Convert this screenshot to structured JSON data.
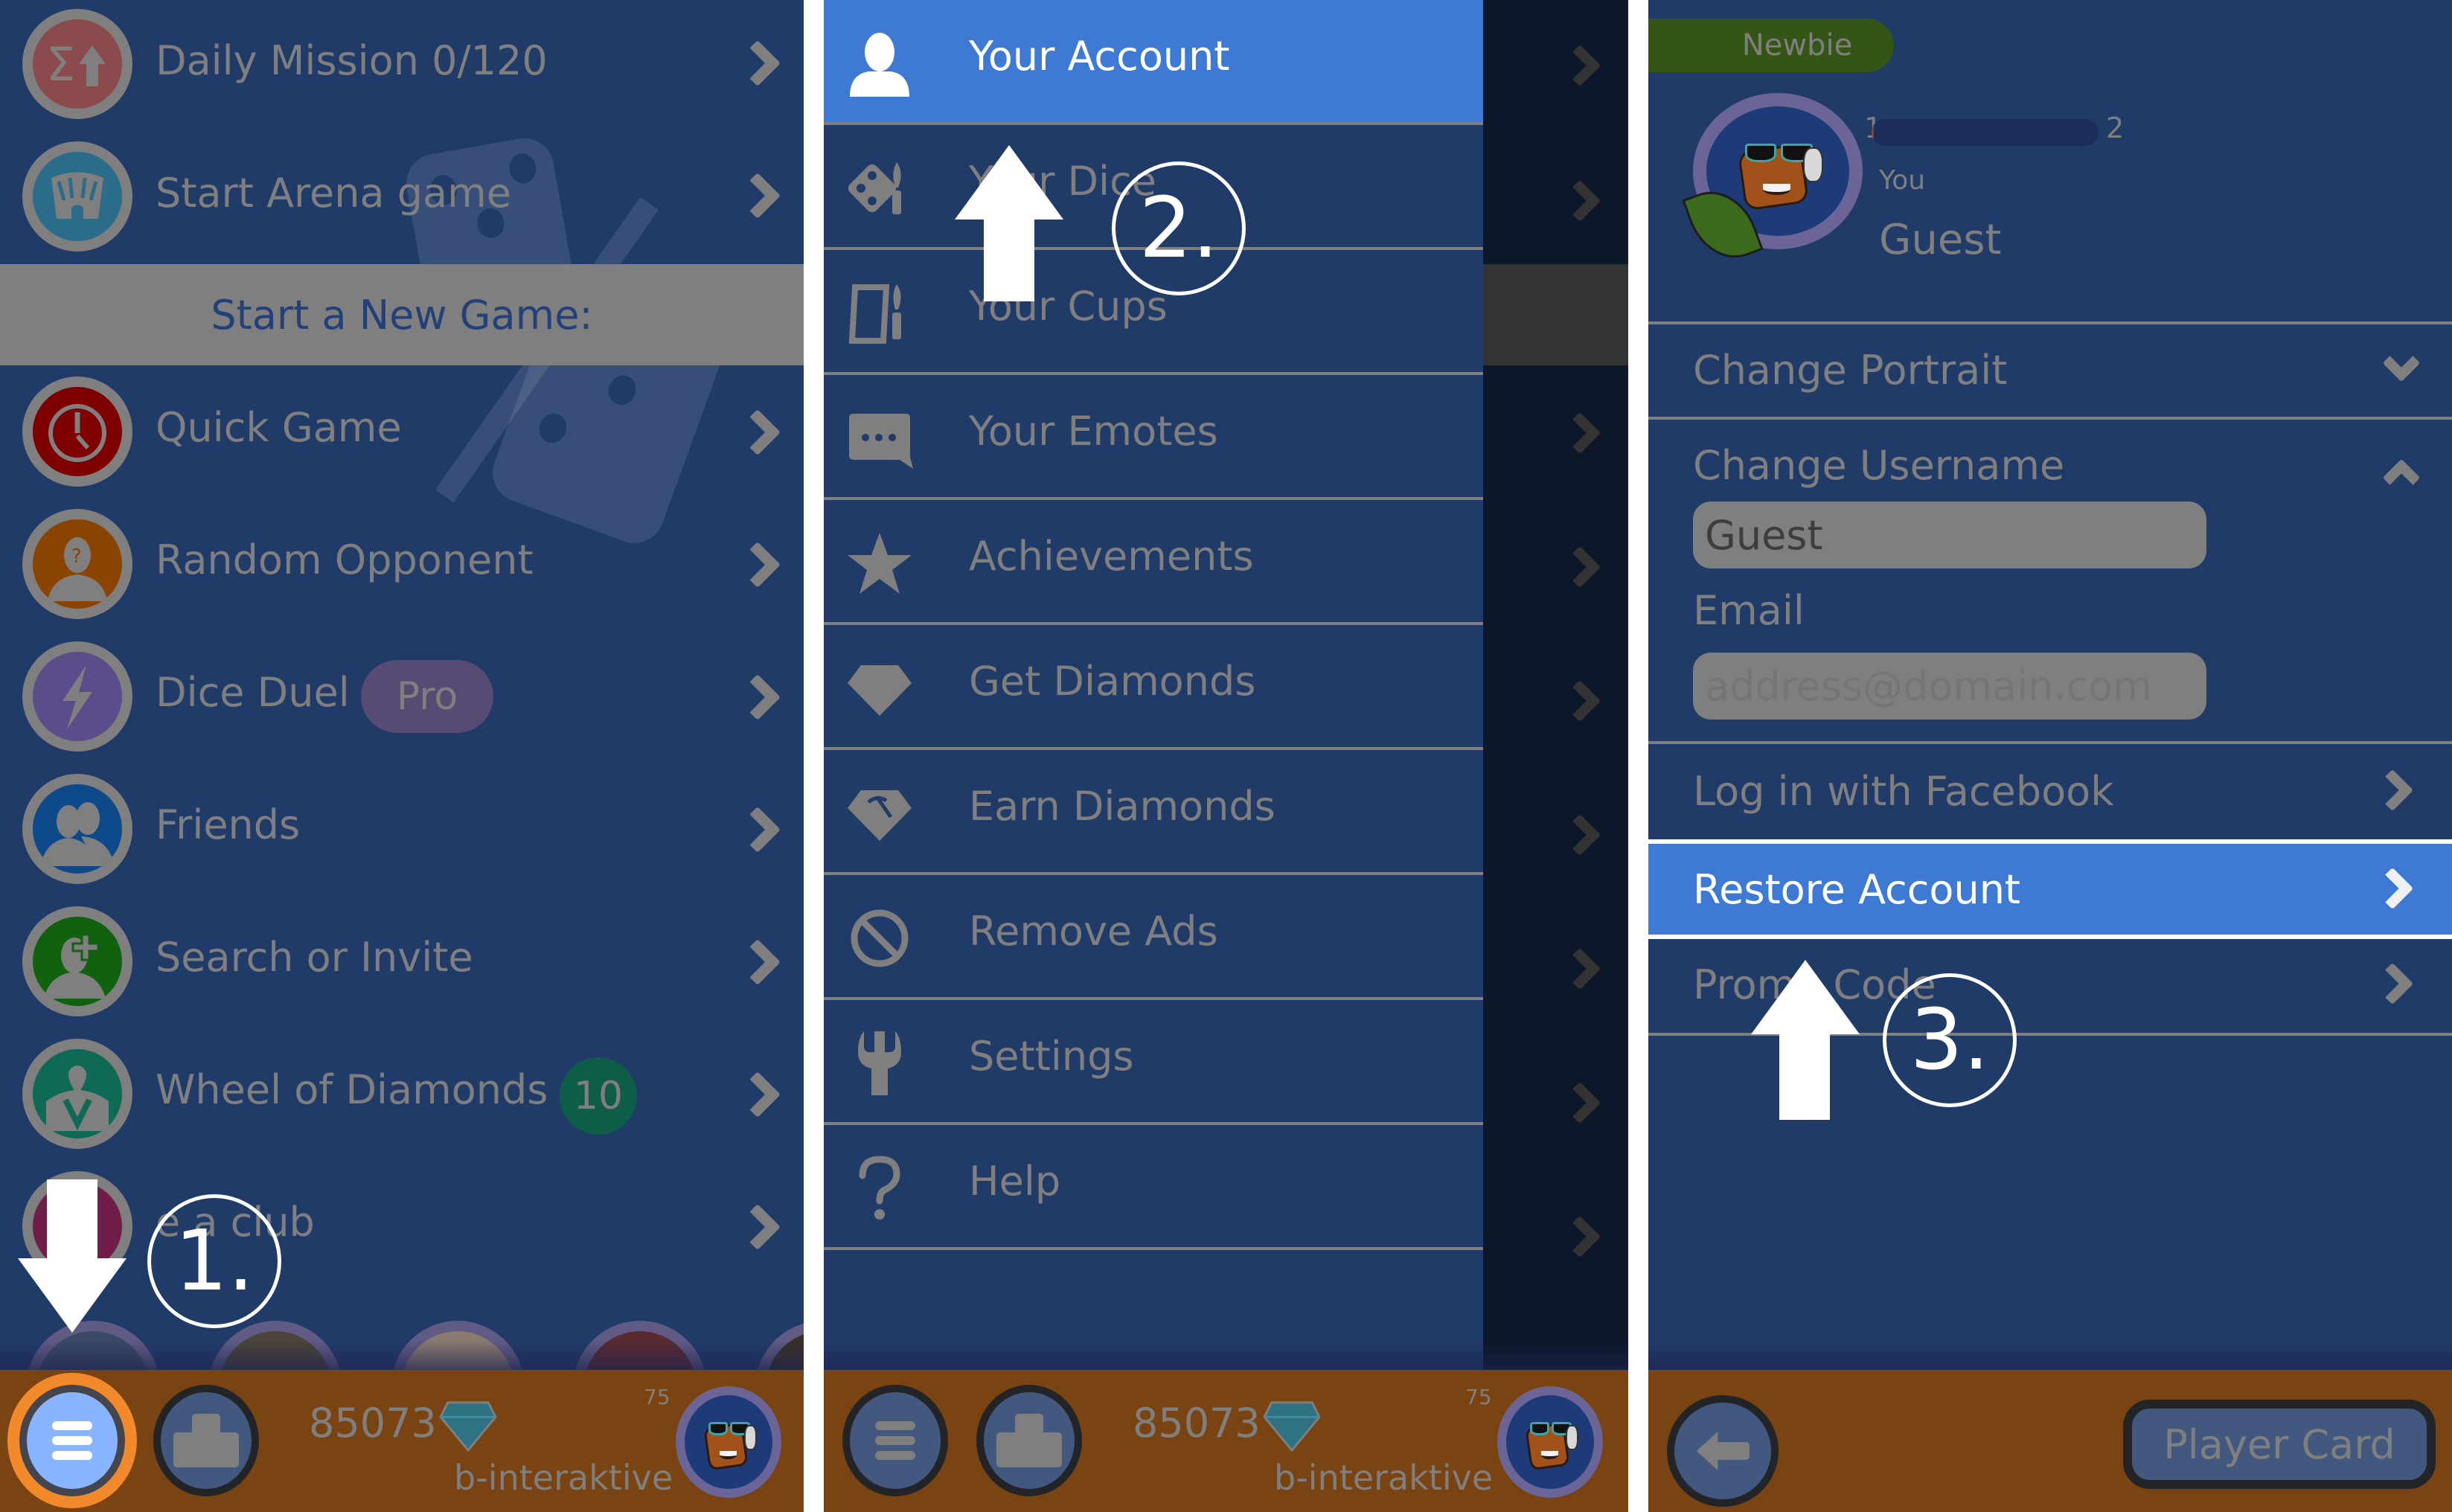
{
  "panel1": {
    "menu_items": [
      {
        "label": "Daily Mission 0/120",
        "icon": "sigma-up-icon",
        "color": "#8b4a4c"
      },
      {
        "label": "Start Arena game",
        "icon": "arena-icon",
        "color": "#2b6c8a"
      }
    ],
    "section_header": "Start a New Game:",
    "game_items": [
      {
        "label": "Quick Game",
        "icon": "stopwatch-icon",
        "color": "#7e0000"
      },
      {
        "label": "Random Opponent",
        "icon": "mystery-person-icon",
        "color": "#8b4300"
      },
      {
        "label": "Dice Duel",
        "icon": "lightning-icon",
        "color": "#5c4d8a",
        "badge": "Pro"
      },
      {
        "label": "Friends",
        "icon": "friends-icon",
        "color": "#0e4a8a"
      },
      {
        "label": "Search or Invite",
        "icon": "add-person-icon",
        "color": "#10620f"
      },
      {
        "label": "Wheel of Diamonds",
        "icon": "wheel-icon",
        "color": "#0f6a55",
        "badge": "10"
      },
      {
        "label": "e a club",
        "icon": "club-icon",
        "color": "#6e1e48"
      }
    ],
    "step_label": "1."
  },
  "bottom_bar": {
    "diamonds": "85073",
    "level": "75",
    "username": "b-interaktive"
  },
  "panel2": {
    "menu": [
      {
        "label": "Your Account",
        "icon": "user-icon",
        "active": true
      },
      {
        "label": "Your Dice",
        "icon": "dice-paint-icon"
      },
      {
        "label": "Your Cups",
        "icon": "cup-paint-icon"
      },
      {
        "label": "Your Emotes",
        "icon": "chat-bubble-icon"
      },
      {
        "label": "Achievements",
        "icon": "star-icon"
      },
      {
        "label": "Get Diamonds",
        "icon": "diamond-icon"
      },
      {
        "label": "Earn Diamonds",
        "icon": "diamond-pickaxe-icon"
      },
      {
        "label": "Remove Ads",
        "icon": "no-entry-icon"
      },
      {
        "label": "Settings",
        "icon": "wrench-icon"
      },
      {
        "label": "Help",
        "icon": "question-icon"
      }
    ],
    "step_label": "2."
  },
  "panel3": {
    "rank_badge": "Newbie",
    "level_from": "1",
    "level_to": "2",
    "level_progress_percent": 1,
    "you_label": "You",
    "name": "Guest",
    "change_portrait": "Change Portrait",
    "change_username": "Change Username",
    "username_value": "Guest",
    "email_label": "Email",
    "email_placeholder": "address@domain.com",
    "facebook_login": "Log in with Facebook",
    "restore_account": "Restore Account",
    "promo_code": "Promo Code",
    "player_card": "Player Card",
    "step_label": "3."
  },
  "colors": {
    "background": "#213b69",
    "active_row": "#3e79d4",
    "bottom_bar": "#7a4312",
    "highlight_ring": "#f2892a"
  }
}
